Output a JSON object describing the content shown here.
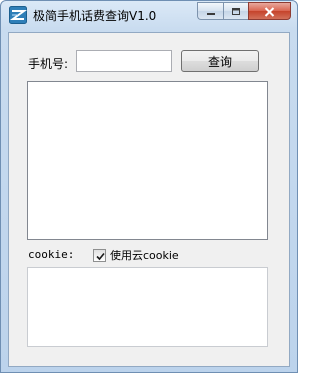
{
  "window": {
    "title": "极简手机话费查询V1.0",
    "icon": "app-logo-icon",
    "caption_buttons": [
      "minimize-icon",
      "maximize-icon",
      "close-icon"
    ]
  },
  "form": {
    "phone_label": "手机号:",
    "phone_value": "",
    "query_button": "查询"
  },
  "result": {
    "content": ""
  },
  "cookie": {
    "label": "cookie:",
    "use_cloud_label": "使用云cookie",
    "use_cloud_checked": true,
    "content": ""
  },
  "colors": {
    "close_button": "#c5432b",
    "frame": "#bcd3ec",
    "client_bg": "#f0f0f0"
  }
}
